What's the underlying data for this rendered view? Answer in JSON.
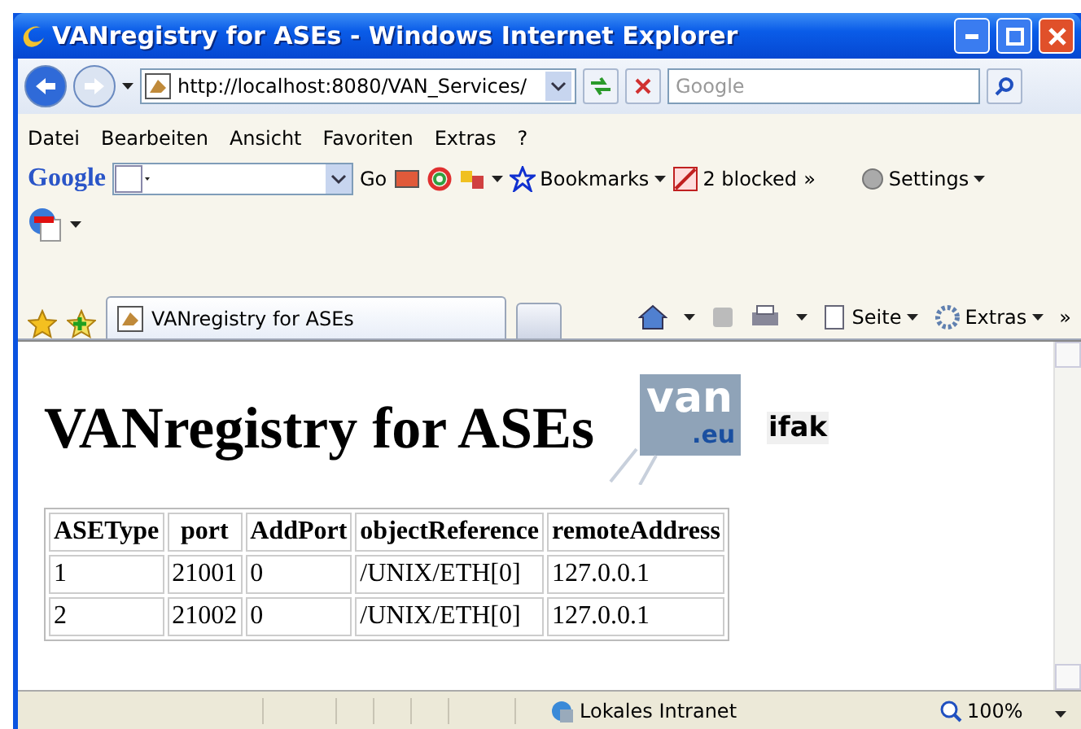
{
  "window": {
    "title": "VANregistry for ASEs - Windows Internet Explorer"
  },
  "address_bar": {
    "url": "http://localhost:8080/VAN_Services/",
    "search_placeholder": "Google"
  },
  "menu": [
    "Datei",
    "Bearbeiten",
    "Ansicht",
    "Favoriten",
    "Extras",
    "?"
  ],
  "google_toolbar": {
    "logo": "Google",
    "go": "Go",
    "bookmarks": "Bookmarks",
    "blocked": "2 blocked",
    "more": "»",
    "settings": "Settings"
  },
  "tabs": [
    {
      "label": "VANregistry for ASEs",
      "selected": true
    }
  ],
  "command_bar": {
    "page": "Seite",
    "tools": "Extras",
    "more": "»"
  },
  "page": {
    "heading": "VANregistry for ASEs",
    "logo_van": "van",
    "logo_eu": ".eu",
    "logo_ifak": "ifak",
    "table": {
      "columns": [
        "ASEType",
        "port",
        "AddPort",
        "objectReference",
        "remoteAddress"
      ],
      "rows": [
        [
          "1",
          "21001",
          "0",
          "/UNIX/ETH[0]",
          "127.0.0.1"
        ],
        [
          "2",
          "21002",
          "0",
          "/UNIX/ETH[0]",
          "127.0.0.1"
        ]
      ]
    }
  },
  "status_bar": {
    "zone": "Lokales Intranet",
    "zoom": "100%"
  }
}
